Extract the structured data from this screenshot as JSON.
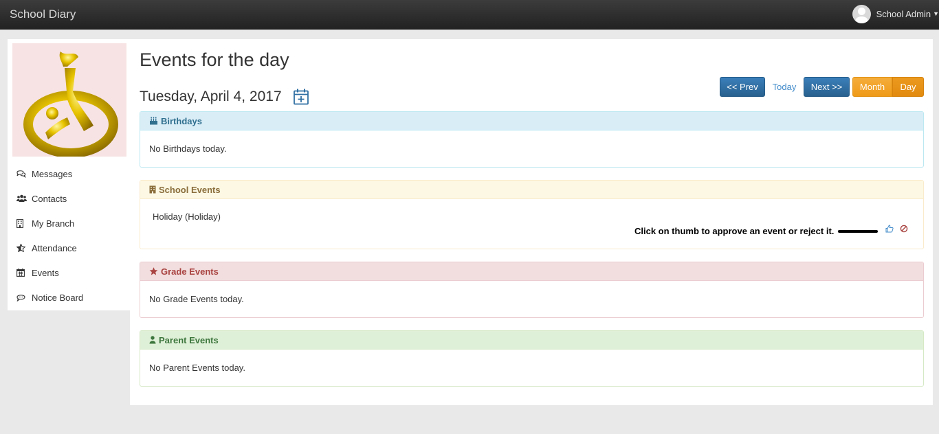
{
  "navbar": {
    "brand": "School Diary",
    "user_name": "School Admin"
  },
  "sidebar": {
    "items": [
      {
        "label": "Messages",
        "icon": "comments-icon"
      },
      {
        "label": "Contacts",
        "icon": "users-icon"
      },
      {
        "label": "My Branch",
        "icon": "building-icon"
      },
      {
        "label": "Attendance",
        "icon": "star-half-icon"
      },
      {
        "label": "Events",
        "icon": "calendar-icon"
      },
      {
        "label": "Notice Board",
        "icon": "comment-icon"
      }
    ]
  },
  "main": {
    "title": "Events for the day",
    "date": "Tuesday, April 4, 2017",
    "nav": {
      "prev": "<< Prev",
      "today": "Today",
      "next": "Next >>",
      "month": "Month",
      "day": "Day"
    },
    "panels": {
      "birthdays": {
        "title": "Birthdays",
        "body": "No Birthdays today."
      },
      "school_events": {
        "title": "School Events",
        "event": "Holiday (Holiday)",
        "hint": "Click on thumb to approve an event or reject it."
      },
      "grade_events": {
        "title": "Grade Events",
        "body": "No Grade Events today."
      },
      "parent_events": {
        "title": "Parent Events",
        "body": "No Parent Events today."
      }
    }
  },
  "colors": {
    "navbar": "#2a2a2a",
    "primary_button": "#2f6fa3",
    "warning_button": "#f0a22b",
    "info_panel": "#d9edf7",
    "warning_panel": "#fcf8e3",
    "danger_panel": "#f2dede",
    "success_panel": "#dff0d8"
  }
}
